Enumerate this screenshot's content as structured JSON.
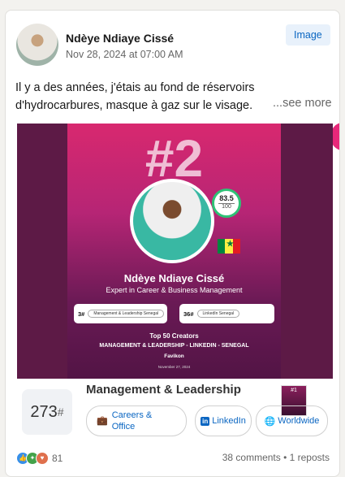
{
  "post": {
    "author": "Ndèye Ndiaye Cissé",
    "date": "Nov 28, 2024 at 07:00 AM",
    "type_badge": "Image",
    "text_line1": "Il y a des années, j'étais au fond de réservoirs",
    "text_line2": "d'hydrocarbures, masque à gaz sur le visage.",
    "see_more": "...see more"
  },
  "media": {
    "rank": "#2",
    "score": "83.5",
    "score_max": "100",
    "name": "Ndèye Ndiaye Cissé",
    "title": "Expert in Career & Business Management",
    "rank_left_num": "3#",
    "rank_left_label": "Management & Leadership Senegal",
    "rank_right_num": "36#",
    "rank_right_label": "LinkedIn Senegal",
    "top_line": "Top 50 Creators",
    "categories_line": "MANAGEMENT & LEADERSHIP - LINKEDIN - SENEGAL",
    "brand": "Favikon",
    "image_date": "November 27, 2024",
    "flag_colors": [
      "#00853f",
      "#fdef42",
      "#e31b23"
    ]
  },
  "ranking": {
    "rank_value": "273",
    "rank_suffix": "#",
    "category": "Management & Leadership",
    "thumb_rank": "#1",
    "tags": [
      {
        "icon": "briefcase-icon",
        "label": "Careers & Office"
      },
      {
        "icon": "linkedin-icon",
        "icon_text": "in",
        "label": "LinkedIn"
      },
      {
        "icon": "globe-icon",
        "label": "Worldwide"
      }
    ]
  },
  "footer": {
    "reaction_icons": [
      "like-icon",
      "support-icon",
      "love-icon"
    ],
    "reaction_count": "81",
    "stats": "38 comments • 1 reposts"
  }
}
